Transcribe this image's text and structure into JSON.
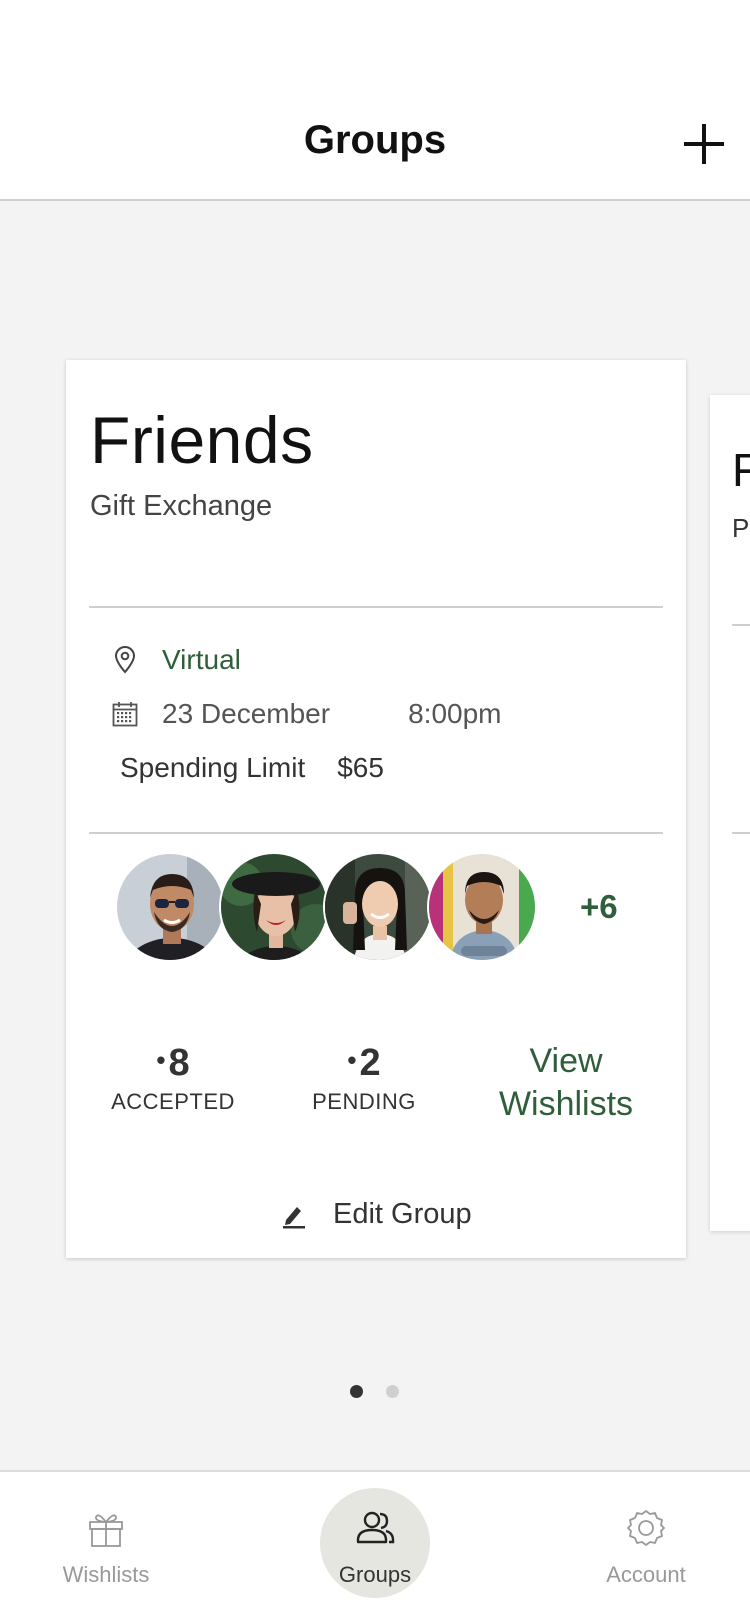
{
  "header": {
    "title": "Groups",
    "add_icon": "plus-icon"
  },
  "group_card": {
    "name": "Friends",
    "type": "Gift Exchange",
    "location_icon": "map-pin-icon",
    "location": "Virtual",
    "date_icon": "calendar-icon",
    "date": "23 December",
    "time": "8:00pm",
    "spending_limit_label": "Spending Limit",
    "spending_limit_value": "$65",
    "avatars": [
      "avatar-1",
      "avatar-2",
      "avatar-3",
      "avatar-4"
    ],
    "more_members": "+6",
    "accepted_count": "8",
    "accepted_label": "ACCEPTED",
    "pending_count": "2",
    "pending_label": "PENDING",
    "view_wishlists": "View Wishlists",
    "edit_icon": "pencil-icon",
    "edit_group": "Edit Group"
  },
  "next_card": {
    "name_partial": "F",
    "type_partial": "Pa"
  },
  "pager": {
    "pages": 2,
    "active_index": 0
  },
  "tabbar": {
    "items": [
      {
        "label": "Wishlists",
        "icon": "gift-icon",
        "active": false
      },
      {
        "label": "Groups",
        "icon": "users-icon",
        "active": true
      },
      {
        "label": "Account",
        "icon": "gear-icon",
        "active": false
      }
    ]
  },
  "colors": {
    "accent_green": "#2f5e3a",
    "background": "#f3f3f3",
    "active_tab_bg": "#e5e6e0"
  }
}
